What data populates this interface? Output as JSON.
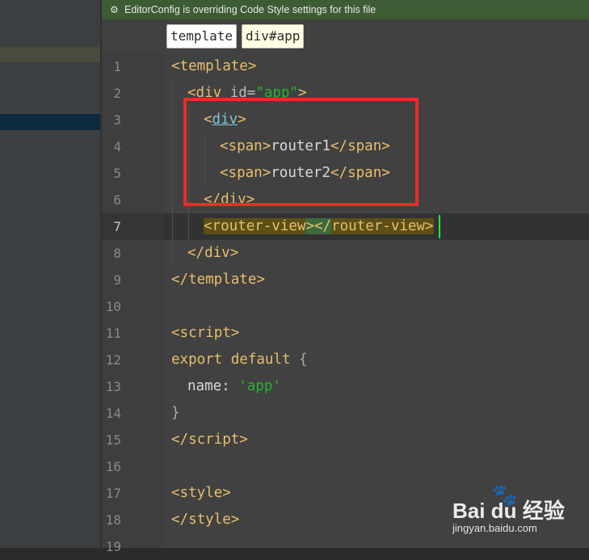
{
  "banner": {
    "text": "EditorConfig is overriding Code Style settings for this file",
    "icon": "editorconfig-icon"
  },
  "breadcrumbs": [
    "template",
    "div#app"
  ],
  "current_line": 7,
  "lines": [
    {
      "n": "1"
    },
    {
      "n": "2"
    },
    {
      "n": "3"
    },
    {
      "n": "4"
    },
    {
      "n": "5"
    },
    {
      "n": "6"
    },
    {
      "n": "7"
    },
    {
      "n": "8"
    },
    {
      "n": "9"
    },
    {
      "n": "10"
    },
    {
      "n": "11"
    },
    {
      "n": "12"
    },
    {
      "n": "13"
    },
    {
      "n": "14"
    },
    {
      "n": "15"
    },
    {
      "n": "16"
    },
    {
      "n": "17"
    },
    {
      "n": "18"
    },
    {
      "n": "19"
    }
  ],
  "code": {
    "l1": [
      "<",
      "template",
      ">"
    ],
    "l2": [
      "<",
      "div",
      " id=",
      "\"app\"",
      ">"
    ],
    "l3": [
      "<",
      "div",
      ">"
    ],
    "l4": [
      "<",
      "span",
      ">",
      "router1",
      "</",
      "span",
      ">"
    ],
    "l5": [
      "<",
      "span",
      ">",
      "router2",
      "</",
      "span",
      ">"
    ],
    "l6": [
      "</",
      "div",
      ">"
    ],
    "l7": [
      "<",
      "router-view",
      ">",
      "</",
      "router-view",
      ">"
    ],
    "l8": [
      "</",
      "div",
      ">"
    ],
    "l9": [
      "</",
      "template",
      ">"
    ],
    "l11": [
      "<",
      "script",
      ">"
    ],
    "l12": [
      "export default",
      " {"
    ],
    "l13": [
      "name",
      ": ",
      "'app'"
    ],
    "l14": [
      "}"
    ],
    "l15": [
      "</",
      "script",
      ">"
    ],
    "l17": [
      "<",
      "style",
      ">"
    ],
    "l18": [
      "</",
      "style",
      ">"
    ]
  },
  "watermark": {
    "logo": "Bai du",
    "brand": "经验",
    "url": "jingyan.baidu.com"
  },
  "colors": {
    "banner": "#3E5C33",
    "tag": "#E8BF6A",
    "keyword": "#CC7832",
    "string": "#25B52D",
    "highlight_box": "#EE2A2A",
    "caret": "#1AEB3B"
  }
}
